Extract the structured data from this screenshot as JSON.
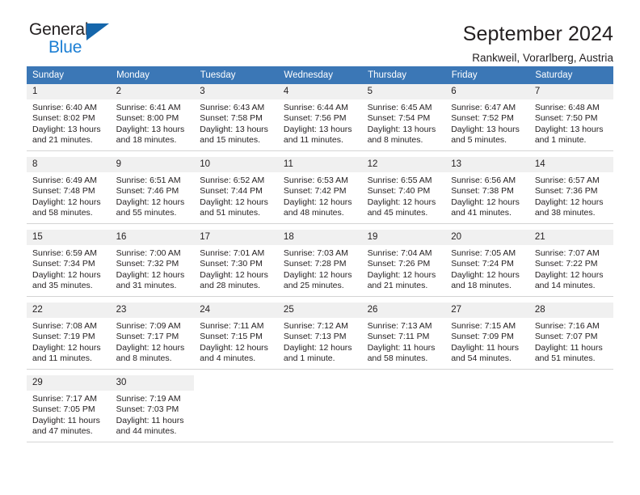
{
  "brand": {
    "name_top": "General",
    "name_bottom": "Blue",
    "logo_color": "#1566ab",
    "text_color": "#1c7fd4"
  },
  "header": {
    "title": "September 2024",
    "subtitle": "Rankweil, Vorarlberg, Austria"
  },
  "theme": {
    "header_bg": "#3b77b6",
    "header_text": "#ffffff",
    "daynum_bg": "#f0f0f0",
    "body_text": "#231f20",
    "grid_line": "#d4d4d4"
  },
  "weekdays": [
    "Sunday",
    "Monday",
    "Tuesday",
    "Wednesday",
    "Thursday",
    "Friday",
    "Saturday"
  ],
  "weeks": [
    [
      {
        "day": "1",
        "sunrise": "Sunrise: 6:40 AM",
        "sunset": "Sunset: 8:02 PM",
        "daylight1": "Daylight: 13 hours",
        "daylight2": "and 21 minutes."
      },
      {
        "day": "2",
        "sunrise": "Sunrise: 6:41 AM",
        "sunset": "Sunset: 8:00 PM",
        "daylight1": "Daylight: 13 hours",
        "daylight2": "and 18 minutes."
      },
      {
        "day": "3",
        "sunrise": "Sunrise: 6:43 AM",
        "sunset": "Sunset: 7:58 PM",
        "daylight1": "Daylight: 13 hours",
        "daylight2": "and 15 minutes."
      },
      {
        "day": "4",
        "sunrise": "Sunrise: 6:44 AM",
        "sunset": "Sunset: 7:56 PM",
        "daylight1": "Daylight: 13 hours",
        "daylight2": "and 11 minutes."
      },
      {
        "day": "5",
        "sunrise": "Sunrise: 6:45 AM",
        "sunset": "Sunset: 7:54 PM",
        "daylight1": "Daylight: 13 hours",
        "daylight2": "and 8 minutes."
      },
      {
        "day": "6",
        "sunrise": "Sunrise: 6:47 AM",
        "sunset": "Sunset: 7:52 PM",
        "daylight1": "Daylight: 13 hours",
        "daylight2": "and 5 minutes."
      },
      {
        "day": "7",
        "sunrise": "Sunrise: 6:48 AM",
        "sunset": "Sunset: 7:50 PM",
        "daylight1": "Daylight: 13 hours",
        "daylight2": "and 1 minute."
      }
    ],
    [
      {
        "day": "8",
        "sunrise": "Sunrise: 6:49 AM",
        "sunset": "Sunset: 7:48 PM",
        "daylight1": "Daylight: 12 hours",
        "daylight2": "and 58 minutes."
      },
      {
        "day": "9",
        "sunrise": "Sunrise: 6:51 AM",
        "sunset": "Sunset: 7:46 PM",
        "daylight1": "Daylight: 12 hours",
        "daylight2": "and 55 minutes."
      },
      {
        "day": "10",
        "sunrise": "Sunrise: 6:52 AM",
        "sunset": "Sunset: 7:44 PM",
        "daylight1": "Daylight: 12 hours",
        "daylight2": "and 51 minutes."
      },
      {
        "day": "11",
        "sunrise": "Sunrise: 6:53 AM",
        "sunset": "Sunset: 7:42 PM",
        "daylight1": "Daylight: 12 hours",
        "daylight2": "and 48 minutes."
      },
      {
        "day": "12",
        "sunrise": "Sunrise: 6:55 AM",
        "sunset": "Sunset: 7:40 PM",
        "daylight1": "Daylight: 12 hours",
        "daylight2": "and 45 minutes."
      },
      {
        "day": "13",
        "sunrise": "Sunrise: 6:56 AM",
        "sunset": "Sunset: 7:38 PM",
        "daylight1": "Daylight: 12 hours",
        "daylight2": "and 41 minutes."
      },
      {
        "day": "14",
        "sunrise": "Sunrise: 6:57 AM",
        "sunset": "Sunset: 7:36 PM",
        "daylight1": "Daylight: 12 hours",
        "daylight2": "and 38 minutes."
      }
    ],
    [
      {
        "day": "15",
        "sunrise": "Sunrise: 6:59 AM",
        "sunset": "Sunset: 7:34 PM",
        "daylight1": "Daylight: 12 hours",
        "daylight2": "and 35 minutes."
      },
      {
        "day": "16",
        "sunrise": "Sunrise: 7:00 AM",
        "sunset": "Sunset: 7:32 PM",
        "daylight1": "Daylight: 12 hours",
        "daylight2": "and 31 minutes."
      },
      {
        "day": "17",
        "sunrise": "Sunrise: 7:01 AM",
        "sunset": "Sunset: 7:30 PM",
        "daylight1": "Daylight: 12 hours",
        "daylight2": "and 28 minutes."
      },
      {
        "day": "18",
        "sunrise": "Sunrise: 7:03 AM",
        "sunset": "Sunset: 7:28 PM",
        "daylight1": "Daylight: 12 hours",
        "daylight2": "and 25 minutes."
      },
      {
        "day": "19",
        "sunrise": "Sunrise: 7:04 AM",
        "sunset": "Sunset: 7:26 PM",
        "daylight1": "Daylight: 12 hours",
        "daylight2": "and 21 minutes."
      },
      {
        "day": "20",
        "sunrise": "Sunrise: 7:05 AM",
        "sunset": "Sunset: 7:24 PM",
        "daylight1": "Daylight: 12 hours",
        "daylight2": "and 18 minutes."
      },
      {
        "day": "21",
        "sunrise": "Sunrise: 7:07 AM",
        "sunset": "Sunset: 7:22 PM",
        "daylight1": "Daylight: 12 hours",
        "daylight2": "and 14 minutes."
      }
    ],
    [
      {
        "day": "22",
        "sunrise": "Sunrise: 7:08 AM",
        "sunset": "Sunset: 7:19 PM",
        "daylight1": "Daylight: 12 hours",
        "daylight2": "and 11 minutes."
      },
      {
        "day": "23",
        "sunrise": "Sunrise: 7:09 AM",
        "sunset": "Sunset: 7:17 PM",
        "daylight1": "Daylight: 12 hours",
        "daylight2": "and 8 minutes."
      },
      {
        "day": "24",
        "sunrise": "Sunrise: 7:11 AM",
        "sunset": "Sunset: 7:15 PM",
        "daylight1": "Daylight: 12 hours",
        "daylight2": "and 4 minutes."
      },
      {
        "day": "25",
        "sunrise": "Sunrise: 7:12 AM",
        "sunset": "Sunset: 7:13 PM",
        "daylight1": "Daylight: 12 hours",
        "daylight2": "and 1 minute."
      },
      {
        "day": "26",
        "sunrise": "Sunrise: 7:13 AM",
        "sunset": "Sunset: 7:11 PM",
        "daylight1": "Daylight: 11 hours",
        "daylight2": "and 58 minutes."
      },
      {
        "day": "27",
        "sunrise": "Sunrise: 7:15 AM",
        "sunset": "Sunset: 7:09 PM",
        "daylight1": "Daylight: 11 hours",
        "daylight2": "and 54 minutes."
      },
      {
        "day": "28",
        "sunrise": "Sunrise: 7:16 AM",
        "sunset": "Sunset: 7:07 PM",
        "daylight1": "Daylight: 11 hours",
        "daylight2": "and 51 minutes."
      }
    ],
    [
      {
        "day": "29",
        "sunrise": "Sunrise: 7:17 AM",
        "sunset": "Sunset: 7:05 PM",
        "daylight1": "Daylight: 11 hours",
        "daylight2": "and 47 minutes."
      },
      {
        "day": "30",
        "sunrise": "Sunrise: 7:19 AM",
        "sunset": "Sunset: 7:03 PM",
        "daylight1": "Daylight: 11 hours",
        "daylight2": "and 44 minutes."
      },
      {
        "day": "",
        "sunrise": "",
        "sunset": "",
        "daylight1": "",
        "daylight2": ""
      },
      {
        "day": "",
        "sunrise": "",
        "sunset": "",
        "daylight1": "",
        "daylight2": ""
      },
      {
        "day": "",
        "sunrise": "",
        "sunset": "",
        "daylight1": "",
        "daylight2": ""
      },
      {
        "day": "",
        "sunrise": "",
        "sunset": "",
        "daylight1": "",
        "daylight2": ""
      },
      {
        "day": "",
        "sunrise": "",
        "sunset": "",
        "daylight1": "",
        "daylight2": ""
      }
    ]
  ]
}
